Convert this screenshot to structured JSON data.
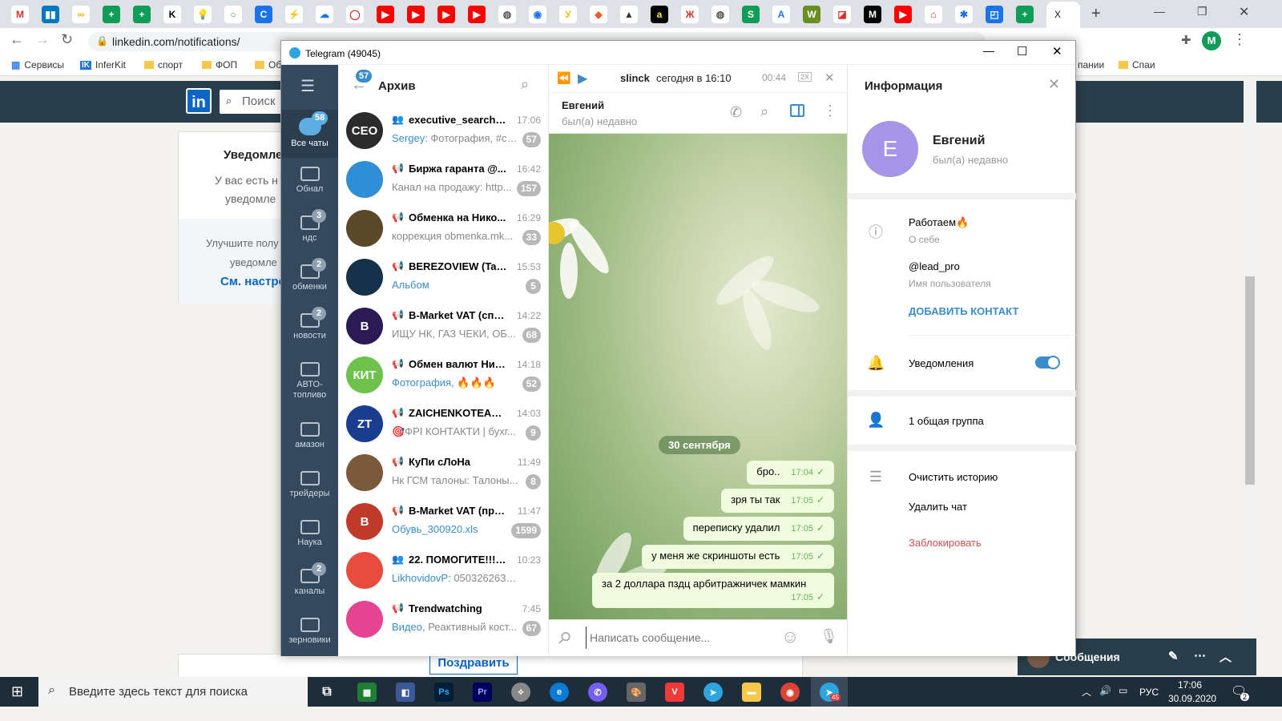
{
  "browser": {
    "url": "linkedin.com/notifications/",
    "active_tab_label": "X",
    "bookmarks": [
      "Сервисы",
      "InferKit",
      "спорт",
      "ФОП",
      "Об",
      "пании",
      "Спаи"
    ]
  },
  "linkedin": {
    "search_placeholder": "Поиск",
    "card_title": "Уведомле",
    "card_text1": "У вас есть н",
    "card_text2": "уведомле",
    "card_text3": "Улучшите полу",
    "card_text4": "уведомле",
    "card_link": "См. настро",
    "congrats_button": "Поздравить",
    "messaging_label": "Сообщения"
  },
  "telegram": {
    "window_title": "Telegram (49045)",
    "folders": [
      {
        "label": "Все чаты",
        "badge": "58"
      },
      {
        "label": "Обнал",
        "badge": ""
      },
      {
        "label": "ндс",
        "badge": "3"
      },
      {
        "label": "обменки",
        "badge": "2"
      },
      {
        "label": "новости",
        "badge": "2"
      },
      {
        "label": "АВТО-\nтопливо",
        "badge": ""
      },
      {
        "label": "амазон",
        "badge": ""
      },
      {
        "label": "трейдеры",
        "badge": ""
      },
      {
        "label": "Наука",
        "badge": ""
      },
      {
        "label": "каналы",
        "badge": "2"
      },
      {
        "label": "зерновики",
        "badge": ""
      }
    ],
    "list_header": {
      "title": "Архив",
      "back_badge": "57"
    },
    "chats": [
      {
        "name": "executive_search_ua",
        "time": "17:06",
        "prefix": "Sergey: ",
        "preview": "Фотография, #се...",
        "badge": "57",
        "kind": "👥",
        "avatar_text": "CEO",
        "color": "#2b2b2b"
      },
      {
        "name": "Биржа гаранта @...",
        "time": "16:42",
        "prefix": "",
        "preview": "Канал на продажу: http...",
        "badge": "157",
        "kind": "📢",
        "avatar_text": "",
        "color": "#2f8fd6"
      },
      {
        "name": "Обменка на Нико...",
        "time": "16:29",
        "prefix": "",
        "preview": "коррекция obmenka.mk...",
        "badge": "33",
        "kind": "📢",
        "avatar_text": "",
        "color": "#5a4a2a"
      },
      {
        "name": "BEREZOVIEW (Tara...",
        "time": "15:53",
        "prefix": "Альбом",
        "preview": "",
        "badge": "5",
        "kind": "📢",
        "avatar_text": "",
        "color": "#16324a"
      },
      {
        "name": "B-Market VAT (спрос)",
        "time": "14:22",
        "prefix": "",
        "preview": "ИЩУ  НК, ГАЗ ЧЕКИ, ОБ...",
        "badge": "68",
        "kind": "📢",
        "avatar_text": "B",
        "color": "#2c1a55"
      },
      {
        "name": "Обмен валют Ник...",
        "time": "14:18",
        "prefix": "Фотография, ",
        "preview": "🔥🔥🔥",
        "badge": "52",
        "kind": "📢",
        "avatar_text": "КИТ",
        "color": "#6cc24a"
      },
      {
        "name": "ZAICHENKOTEAM.C...",
        "time": "14:03",
        "prefix": "",
        "preview": "🎯ФРІ КОНТАКТИ | бухг...",
        "badge": "9",
        "kind": "📢",
        "avatar_text": "ZT",
        "color": "#1a3d8f"
      },
      {
        "name": "КуПи сЛоНа",
        "time": "11:49",
        "prefix": "",
        "preview": "Нк ГСМ талоны:  Талоны...",
        "badge": "8",
        "kind": "📢",
        "avatar_text": "",
        "color": "#7a5a3a"
      },
      {
        "name": "B-Market VAT (пре...",
        "time": "11:47",
        "prefix": "Обувь_300920.xls",
        "preview": "",
        "badge": "1599",
        "kind": "📢",
        "avatar_text": "B",
        "color": "#c0392b"
      },
      {
        "name": "22. ПОМОГИТЕ!!!! ...",
        "time": "10:23",
        "prefix": "LikhovidovP: ",
        "preview": "0503262630 его ...",
        "badge": "",
        "kind": "👥",
        "avatar_text": "",
        "color": "#e74c3c"
      },
      {
        "name": "Trendwatching",
        "time": "7:45",
        "prefix": "Видео, ",
        "preview": "Реактивный кост...",
        "badge": "67",
        "kind": "📢",
        "avatar_text": "",
        "color": "#e84393"
      }
    ],
    "player": {
      "title": "slinck",
      "subtitle": "сегодня в 16:10",
      "duration": "00:44",
      "speed": "2X"
    },
    "chat": {
      "name": "Евгений",
      "status": "был(а) недавно",
      "date_chip": "30 сентября",
      "messages": [
        {
          "text": "бро..",
          "time": "17:04"
        },
        {
          "text": "зря ты так",
          "time": "17:05"
        },
        {
          "text": "переписку удалил",
          "time": "17:05"
        },
        {
          "text": "у меня же скриншоты есть",
          "time": "17:05"
        },
        {
          "text": "за 2 доллара пздц арбитражничек мамкин",
          "time": "17:05"
        }
      ],
      "compose_placeholder": "Написать сообщение..."
    },
    "info": {
      "title": "Информация",
      "avatar_letter": "Е",
      "name": "Евгений",
      "status": "был(а) недавно",
      "bio": "Работаем🔥",
      "bio_label": "О себе",
      "username": "@lead_pro",
      "username_label": "Имя пользователя",
      "add_contact": "ДОБАВИТЬ КОНТАКТ",
      "notifications": "Уведомления",
      "notifications_on": true,
      "groups": "1 общая группа",
      "clear_history": "Очистить историю",
      "delete_chat": "Удалить чат",
      "block": "Заблокировать"
    }
  },
  "taskbar": {
    "search_placeholder": "Введите здесь текст для поиска",
    "language": "РУС",
    "time": "17:06",
    "date": "30.09.2020",
    "notification_count": "2",
    "telegram_badge": "45"
  }
}
